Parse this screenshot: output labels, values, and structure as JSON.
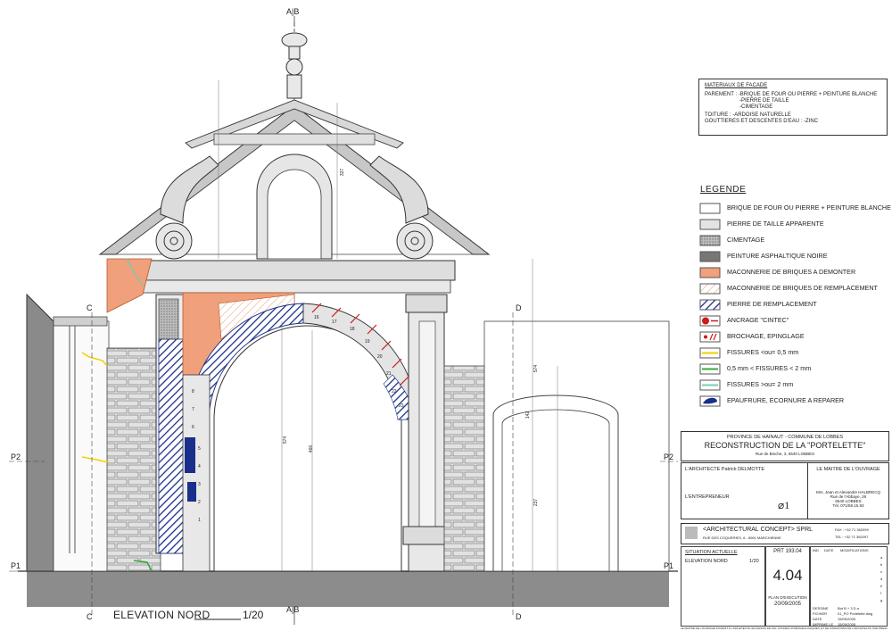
{
  "drawing_title": "ELEVATION NORD",
  "drawing_scale": "1/20",
  "section_marks": {
    "ab_top": "A|B",
    "ab_bottom": "A|B",
    "c": "C",
    "d": "D",
    "p1_left": "P1",
    "p1_right": "P1",
    "p2_left": "P2",
    "p2_right": "P2"
  },
  "dimensions": [
    "327",
    "574",
    "466",
    "574",
    "237",
    "142"
  ],
  "stone_numbers": [
    "16",
    "17",
    "18",
    "19",
    "20",
    "21",
    "22",
    "23",
    "8",
    "7",
    "6",
    "5",
    "4",
    "3",
    "2",
    "1"
  ],
  "materials": {
    "title": "MATERIAUX DE FACADE",
    "lines": [
      "PAREMENT  : -BRIQUE DE FOUR OU PIERRE + PEINTURE BLANCHE",
      "-PIERRE DE TAILLE",
      "-CIMENTAGE",
      "TOITURE    : -ARDOISE NATURELLE",
      "GOUTTIERES ET DESCENTES D'EAU : -ZINC"
    ]
  },
  "legend": {
    "title": "LEGENDE",
    "items": [
      {
        "label": "BRIQUE DE FOUR OU PIERRE + PEINTURE BLANCHE",
        "swatch": "white"
      },
      {
        "label": "PIERRE DE TAILLE APPARENTE",
        "swatch": "lightgray"
      },
      {
        "label": "CIMENTAGE",
        "swatch": "dots"
      },
      {
        "label": "PEINTURE ASPHALTIQUE NOIRE",
        "swatch": "darkgray"
      },
      {
        "label": "MACONNERIE DE BRIQUES A DEMONTER",
        "swatch": "orange"
      },
      {
        "label": "MACONNERIE DE BRIQUES DE REMPLACEMENT",
        "swatch": "hatch-orange"
      },
      {
        "label": "PIERRE DE REMPLACEMENT",
        "swatch": "hatch-blue"
      },
      {
        "label": "ANCRAGE \"CINTEC\"",
        "swatch": "anchor"
      },
      {
        "label": "BROCHAGE, EPINGLAGE",
        "swatch": "pin"
      },
      {
        "label": "FISSURES <ou= 0,5 mm",
        "swatch": "yellow-line"
      },
      {
        "label": "0,5 mm < FISSURES < 2 mm",
        "swatch": "green-line"
      },
      {
        "label": "FISSURES >ou= 2 mm",
        "swatch": "teal-line"
      },
      {
        "label": "EPAUFRURE, ECORNURE A REPARER",
        "swatch": "blue-blob"
      }
    ]
  },
  "colors": {
    "orange": "#f0a07a",
    "blue": "#1a2f8a",
    "stone": "#e3e3e3",
    "dark": "#777777",
    "yellow": "#f5d000",
    "green": "#3aa83a",
    "teal": "#7fc8b0"
  },
  "project": {
    "province": "PROVINCE DE HAINAUT - COMMUNE DE LOBBES",
    "title": "RECONSTRUCTION DE LA \"PORTELETTE\"",
    "address": "Rue de Binche, 3, 6540 LOBBES"
  },
  "architect": {
    "label": "L'ARCHITECTE Patrick DELMOTTE",
    "entrepreneur": "L'ENTREPRENEUR"
  },
  "owner": {
    "label": "LE MAITRE DE L'OUVRAGE",
    "lines": [
      "Mrs. Jean et Alexandre HALBRECQ",
      "Rue de l'Abbaye, 26",
      "6540 LOBBES",
      "Tél. 071/59.15.93"
    ]
  },
  "office": {
    "name": "<ARCHITECTURAL CONCEPT> SPRL",
    "address": "RUE DES COQUERIES, 6 - 6061 MARCHIENNE",
    "fax": "FAX : +32 71 362099",
    "tel": "TEL : +32 71 362097"
  },
  "sheet": {
    "situation": "SITUATION ACTUELLE",
    "view": "ELEVATION NORD",
    "scale": "1/20",
    "prt_label": "PRT",
    "prt": "193.04",
    "number": "4.04",
    "phase": "PLAN D'EXECUTION",
    "date": "20/09/2005",
    "rev_headers": [
      "IND",
      "DATE",
      "MODIFICATIONS"
    ],
    "rev_letters": [
      "a",
      "b",
      "c",
      "d",
      "e",
      "f",
      "g"
    ],
    "meta": [
      {
        "k": "DESSINE",
        "v": "Bot B + 3 D a"
      },
      {
        "k": "FICHIER",
        "v": "01_PO Portelette.dwg"
      },
      {
        "k": "DATE",
        "v": "15/09/2005"
      },
      {
        "k": "IMPRIME LE",
        "v": "15/09/2005"
      }
    ],
    "footer": "LE MAITRE DE L'OUVRAGE FOURNIT A L'ARCHITECTE LES ESSAIS DE SOL, ETUDES HYDROGEOLOGIQUES, ET DE FONDATIONS DE L'ARCHITECTE, PAR PRESOMPTION, DE LA DATE DU DEBUT DES TRAVAUX"
  }
}
